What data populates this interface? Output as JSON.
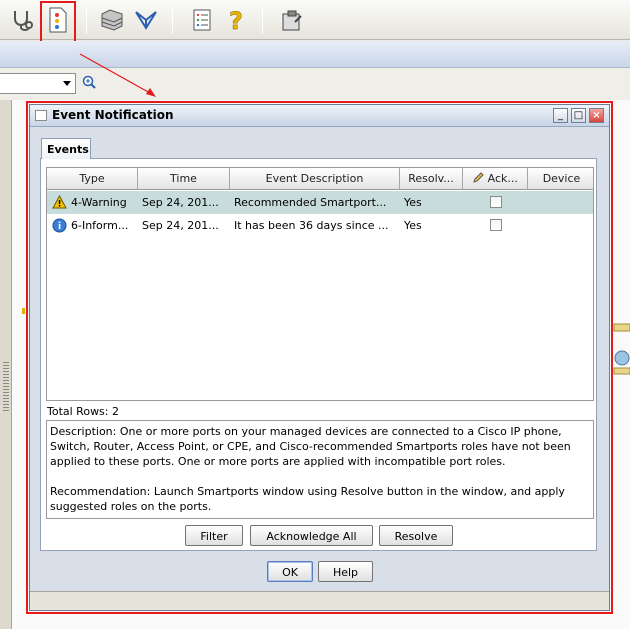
{
  "dialog": {
    "title": "Event Notification",
    "tab_label": "Events",
    "columns": [
      "Type",
      "Time",
      "Event Description",
      "Resolv...",
      "Ack...",
      "Device"
    ],
    "rows": [
      {
        "type": "4-Warning",
        "time": "Sep 24, 201...",
        "description": "Recommended Smartport...",
        "resolvable": "Yes",
        "acknowledged": false,
        "device": "",
        "icon": "warning-icon"
      },
      {
        "type": "6-Inform...",
        "time": "Sep 24, 201...",
        "description": "It has been 36 days since ...",
        "resolvable": "Yes",
        "acknowledged": false,
        "device": "",
        "icon": "info-icon"
      }
    ],
    "total_rows": "Total Rows: 2",
    "details": "Description: One or more ports on your managed devices are connected to a Cisco IP phone, Switch, Router, Access Point, or CPE, and Cisco-recommended Smartports roles have not been applied to these ports. One or more ports are applied with incompatible port roles.\n\nRecommendation: Launch Smartports window using Resolve button in the window, and apply suggested roles on the ports.",
    "buttons": {
      "filter": "Filter",
      "acknowledge_all": "Acknowledge All",
      "resolve": "Resolve",
      "ok": "OK",
      "help": "Help"
    }
  },
  "colors": {
    "highlight": "#e31b1b",
    "selected_row": "#c9dcdc"
  }
}
